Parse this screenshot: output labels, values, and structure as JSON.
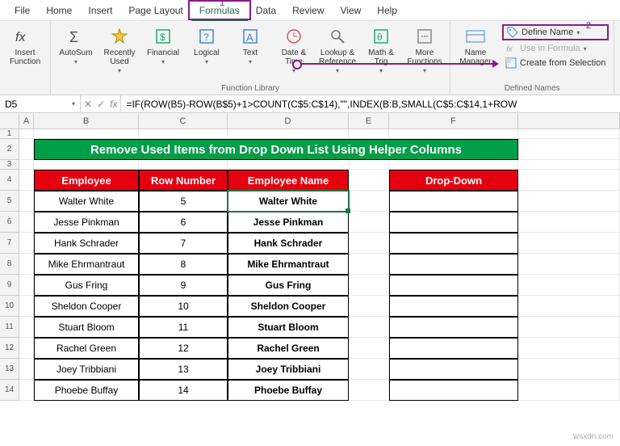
{
  "menu": {
    "items": [
      "File",
      "Home",
      "Insert",
      "Page Layout",
      "Formulas",
      "Data",
      "Review",
      "View",
      "Help"
    ],
    "active": "Formulas",
    "callout1": "1",
    "callout2": "2"
  },
  "ribbon": {
    "insert_function": "Insert Function",
    "lib": {
      "autosum": "AutoSum",
      "recently": "Recently Used",
      "financial": "Financial",
      "logical": "Logical",
      "text": "Text",
      "datetime": "Date & Time",
      "lookup": "Lookup & Reference",
      "math": "Math & Trig",
      "more": "More Functions",
      "group_label": "Function Library"
    },
    "names": {
      "manager": "Name Manager",
      "define": "Define Name",
      "use": "Use in Formula",
      "create": "Create from Selection",
      "group_label": "Defined Names"
    }
  },
  "fbar": {
    "namebox": "D5",
    "formula": "=IF(ROW(B5)-ROW(B$5)+1>COUNT(C$5:C$14),\"\",INDEX(B:B,SMALL(C$5:C$14,1+ROW"
  },
  "grid": {
    "cols": [
      "A",
      "B",
      "C",
      "D",
      "E",
      "F"
    ],
    "rowheads": [
      "1",
      "2",
      "3",
      "4",
      "5",
      "6",
      "7",
      "8",
      "9",
      "10",
      "11",
      "12",
      "13",
      "14"
    ],
    "title": "Remove Used Items from Drop Down List Using Helper Columns",
    "headers": {
      "employee": "Employee",
      "rownum": "Row Number",
      "empname": "Employee Name",
      "dropdown": "Drop-Down"
    },
    "data": [
      {
        "b": "Walter White",
        "c": "5",
        "d": "Walter White"
      },
      {
        "b": "Jesse Pinkman",
        "c": "6",
        "d": "Jesse Pinkman"
      },
      {
        "b": "Hank Schrader",
        "c": "7",
        "d": "Hank Schrader"
      },
      {
        "b": "Mike Ehrmantraut",
        "c": "8",
        "d": "Mike Ehrmantraut"
      },
      {
        "b": "Gus Fring",
        "c": "9",
        "d": "Gus Fring"
      },
      {
        "b": "Sheldon Cooper",
        "c": "10",
        "d": "Sheldon Cooper"
      },
      {
        "b": "Stuart Bloom",
        "c": "11",
        "d": "Stuart Bloom"
      },
      {
        "b": "Rachel Green",
        "c": "12",
        "d": "Rachel Green"
      },
      {
        "b": "Joey Tribbiani",
        "c": "13",
        "d": "Joey Tribbiani"
      },
      {
        "b": "Phoebe Buffay",
        "c": "14",
        "d": "Phoebe Buffay"
      }
    ]
  },
  "watermark": "wsxdn.com"
}
